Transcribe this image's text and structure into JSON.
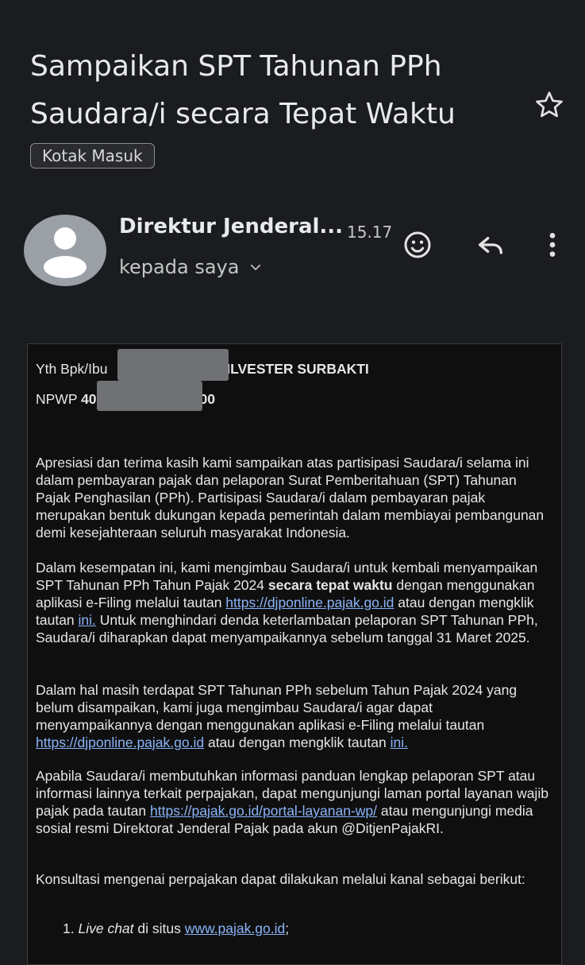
{
  "header": {
    "subject": "Sampaikan SPT Tahunan PPh Saudara/i secara Tepat Waktu",
    "label_chip": "Kotak Masuk"
  },
  "sender": {
    "name": "Direktur Jenderal...",
    "time": "15.17",
    "recipient": "kepada saya"
  },
  "icons": {
    "star": "star-icon",
    "emoji": "add-reaction-icon",
    "reply": "reply-icon",
    "more": "more-vert-icon",
    "avatar": "person-avatar-icon",
    "expand": "chevron-down-icon"
  },
  "body": {
    "greeting_prefix": "Yth Bpk/Ibu",
    "greeting_name": "ILVESTER SURBAKTI",
    "npwp_label": "NPWP",
    "npwp_start": "40",
    "npwp_end": "00",
    "p1_a": "Apresiasi dan terima kasih kami sampaikan atas partisipasi Saudara/i selama ini dalam pembayaran pajak dan pelaporan Surat Pemberitahuan (SPT) Tahunan Pajak Penghasilan (PPh)",
    "p1_b": ". Partisipasi Saudara/i dalam pembayaran pajak merupakan bentuk dukungan kepada pemerintah dalam membiayai pembangunan demi kesejahteraan seluruh masyarakat Indonesia.",
    "p2_a": "Dalam kesempatan ini, kami mengimbau Saudara/i untuk kembali menyampaikan SPT Tahunan PPh Tahun Pajak 2024 ",
    "p2_bold": "secara tepat waktu",
    "p2_b": " dengan menggunakan aplikasi e-Filing melalui tautan ",
    "p2_link1": "https://djponline.pajak.go.id",
    "p2_c": " atau dengan mengklik tautan ",
    "p2_link2": "ini.",
    "p2_d": " Untuk menghindari denda keterlambatan pelaporan SPT Tahunan PPh, Saudara/i diharapkan dapat menyampaikannya sebelum tanggal 31 Maret 2025.",
    "p3_a": "Dalam hal masih terdapat SPT Tahunan PPh sebelum Tahun Pajak 2024 yang belum disampaikan, kami juga mengimbau Saudara/i agar dapat menyampaikannya dengan menggunakan aplikasi e-Filing melalui tautan ",
    "p3_link1": "https://djponline.pajak.go.id",
    "p3_b": " atau dengan mengklik tautan ",
    "p3_link2": "ini.",
    "p4_a": "Apabila Saudara/i membutuhkan informasi panduan lengkap pelaporan SPT atau informasi lainnya terkait perpajakan, dapat mengunjungi laman portal layanan wajib pajak pada tautan ",
    "p4_link": "https://pajak.go.id/portal-layanan-wp/",
    "p4_b": " atau mengunjungi media sosial resmi Direktorat Jenderal Pajak pada akun @DitjenPajakRI.",
    "p5": "Konsultasi mengenai perpajakan dapat dilakukan melalui kanal sebagai berikut:",
    "li1_num": "1.",
    "li1_italic": "Live chat",
    "li1_text": " di situs ",
    "li1_link": "www.pajak.go.id",
    "li1_end": ";"
  }
}
